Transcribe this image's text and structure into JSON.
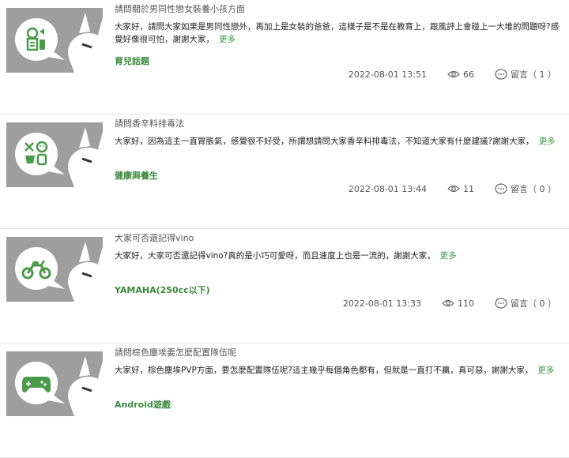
{
  "posts": [
    {
      "title": "請問關於男同性戀女裝養小孩方面",
      "excerpt": "大家好，請問大家如果是男同性戀外，再加上是女裝的爸爸，這樣子是不是在教育上，跟風評上會碰上一大堆的問題呀?感覺好像很可怕，謝謝大家，",
      "more": "更多",
      "category": "育兒話題",
      "date": "2022-08-01 13:51",
      "views": "66",
      "comments": "留言（ 1 ）",
      "icon": "baby-care-icon"
    },
    {
      "title": "請問香辛料排毒法",
      "excerpt": "大家好，因為這主一直胃脹氣，感覺很不好受，所謂想請問大家香辛料排毒法，不知道大家有什麼建議?謝謝大家，",
      "more": "更多",
      "category": "健康與養生",
      "date": "2022-08-01 13:44",
      "views": "11",
      "comments": "留言（ 0 ）",
      "icon": "health-icon"
    },
    {
      "title": "大家可否還記得vino",
      "excerpt": "大家好，大家可否還記得vino?真的是小巧可愛呀，而且速度上也是一流的，謝謝大家，",
      "more": "更多",
      "category": "YAMAHA(250cc以下)",
      "date": "2022-08-01 13:33",
      "views": "110",
      "comments": "留言（ 0 ）",
      "icon": "motorcycle-icon"
    },
    {
      "title": "請問棕色塵埃要怎麼配置隊伍呢",
      "excerpt": "大家好，棕色塵埃PVP方面，要怎麼配置隊伍呢?這主幾乎每個角色都有，但就是一直打不贏，真可惡，謝謝大家，",
      "more": "更多",
      "category": "Android遊戲",
      "date": "",
      "views": "",
      "comments": "",
      "icon": "gamepad-icon"
    }
  ],
  "colors": {
    "accent": "#3a9a46",
    "thumb_bg": "#9e9e9e",
    "icon_green": "#4a9a4a"
  }
}
